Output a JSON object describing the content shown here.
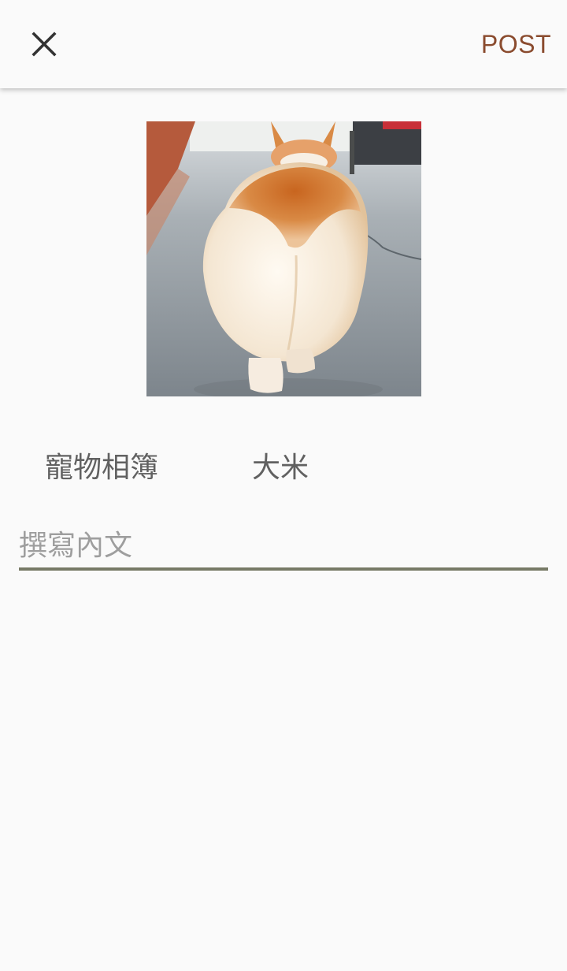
{
  "topbar": {
    "close_icon": "close-icon",
    "post_label": "POST",
    "post_color": "#8a4b2e"
  },
  "photo": {
    "subject": "corgi-rear-view-photo"
  },
  "meta": {
    "album_label": "寵物相簿",
    "pet_name": "大米"
  },
  "content": {
    "placeholder": "撰寫內文",
    "value": ""
  },
  "colors": {
    "background": "#fafafa",
    "text_secondary": "#616161",
    "underline": "#777a66"
  }
}
